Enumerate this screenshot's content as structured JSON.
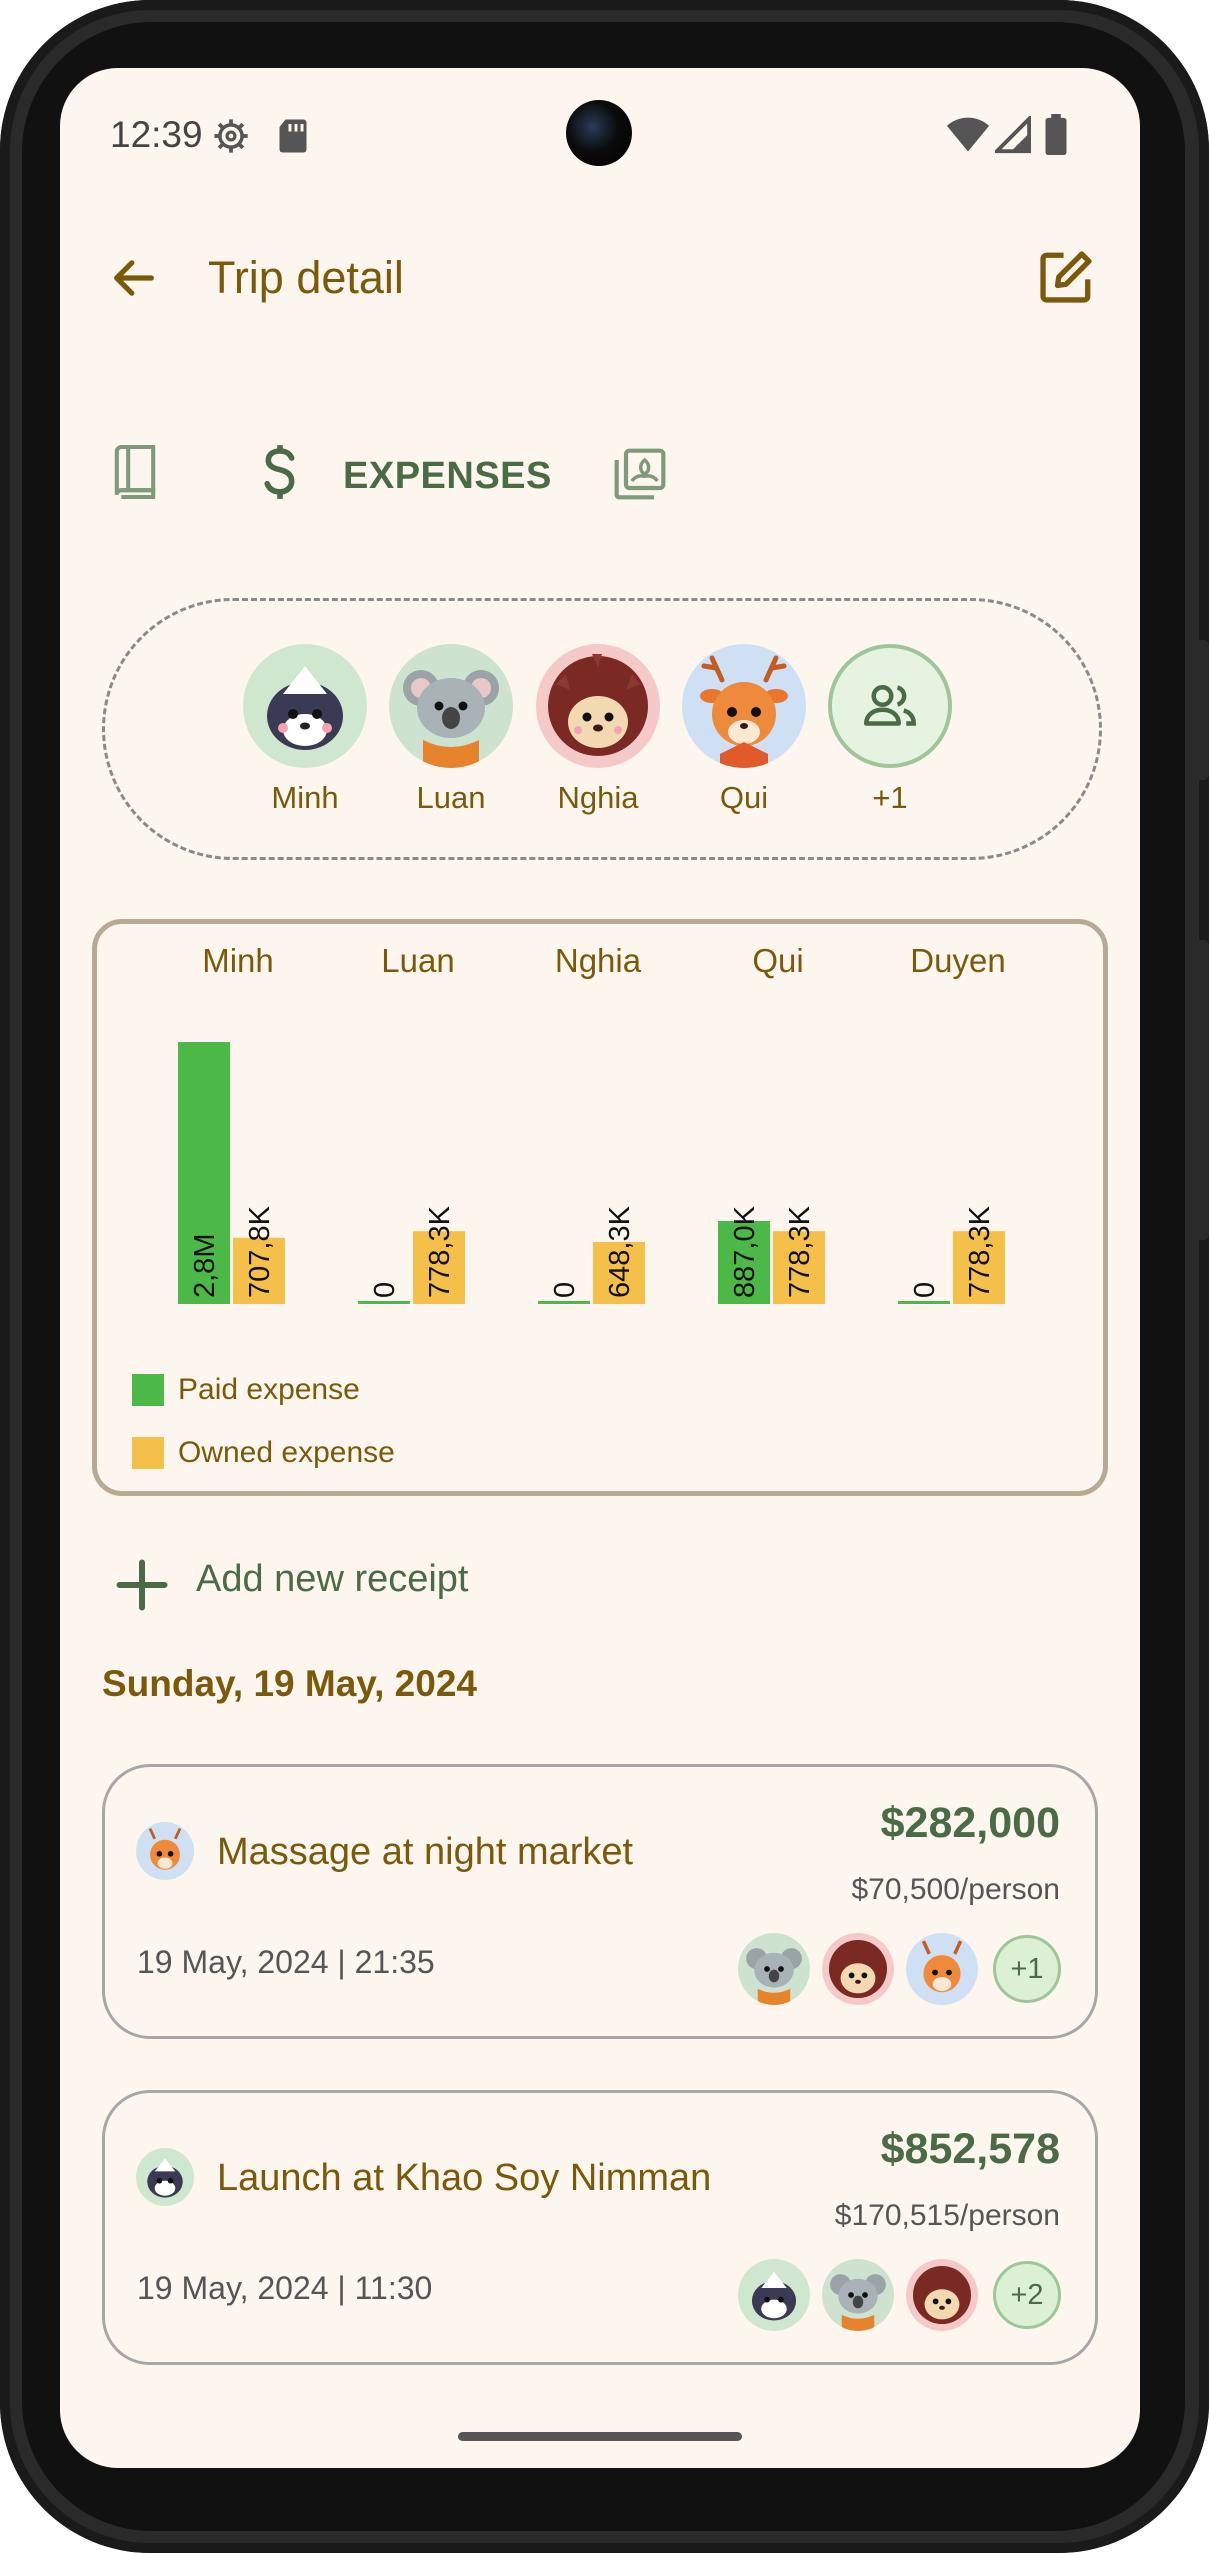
{
  "status": {
    "time": "12:39"
  },
  "topbar": {
    "title": "Trip detail",
    "back_icon": "arrow-left-icon",
    "edit_icon": "edit-icon"
  },
  "tabs": [
    {
      "icon": "book-icon",
      "label": ""
    },
    {
      "icon": "dollar-icon",
      "label": "EXPENSES",
      "selected": true
    },
    {
      "icon": "photo-album-icon",
      "label": ""
    }
  ],
  "members": [
    {
      "name": "Minh",
      "avatar": "skunk-avatar"
    },
    {
      "name": "Luan",
      "avatar": "koala-avatar"
    },
    {
      "name": "Nghia",
      "avatar": "hedgehog-avatar"
    },
    {
      "name": "Qui",
      "avatar": "deer-avatar"
    },
    {
      "name": "+1",
      "avatar": "group-icon"
    }
  ],
  "chart_data": {
    "type": "bar",
    "categories": [
      "Minh",
      "Luan",
      "Nghia",
      "Qui",
      "Duyen"
    ],
    "series": [
      {
        "name": "Paid expense",
        "color": "#4cb848",
        "values": [
          2800000,
          0,
          0,
          887000,
          0
        ],
        "labels": [
          "2,8M",
          "0",
          "0",
          "887,0K",
          "0"
        ]
      },
      {
        "name": "Owned expense",
        "color": "#f5c04a",
        "values": [
          707800,
          778300,
          648300,
          778300,
          778300
        ],
        "labels": [
          "707,8K",
          "778,3K",
          "648,3K",
          "778,3K",
          "778,3K"
        ]
      }
    ],
    "legend": [
      "Paid expense",
      "Owned expense"
    ],
    "legend_position": "bottom-left"
  },
  "actions": {
    "add_receipt": "Add new receipt"
  },
  "date_header": "Sunday, 19 May, 2024",
  "receipts": [
    {
      "title": "Massage at night market",
      "amount": "$282,000",
      "per_person": "$70,500/person",
      "datetime": "19 May, 2024 | 21:35",
      "payer_avatar": "deer-avatar",
      "participants": [
        "koala-avatar",
        "hedgehog-avatar",
        "deer-avatar"
      ],
      "more": "+1"
    },
    {
      "title": "Launch at Khao Soy Nimman",
      "amount": "$852,578",
      "per_person": "$170,515/person",
      "datetime": "19 May, 2024 | 11:30",
      "payer_avatar": "skunk-avatar",
      "participants": [
        "skunk-avatar",
        "koala-avatar",
        "hedgehog-avatar"
      ],
      "more": "+2"
    }
  ]
}
